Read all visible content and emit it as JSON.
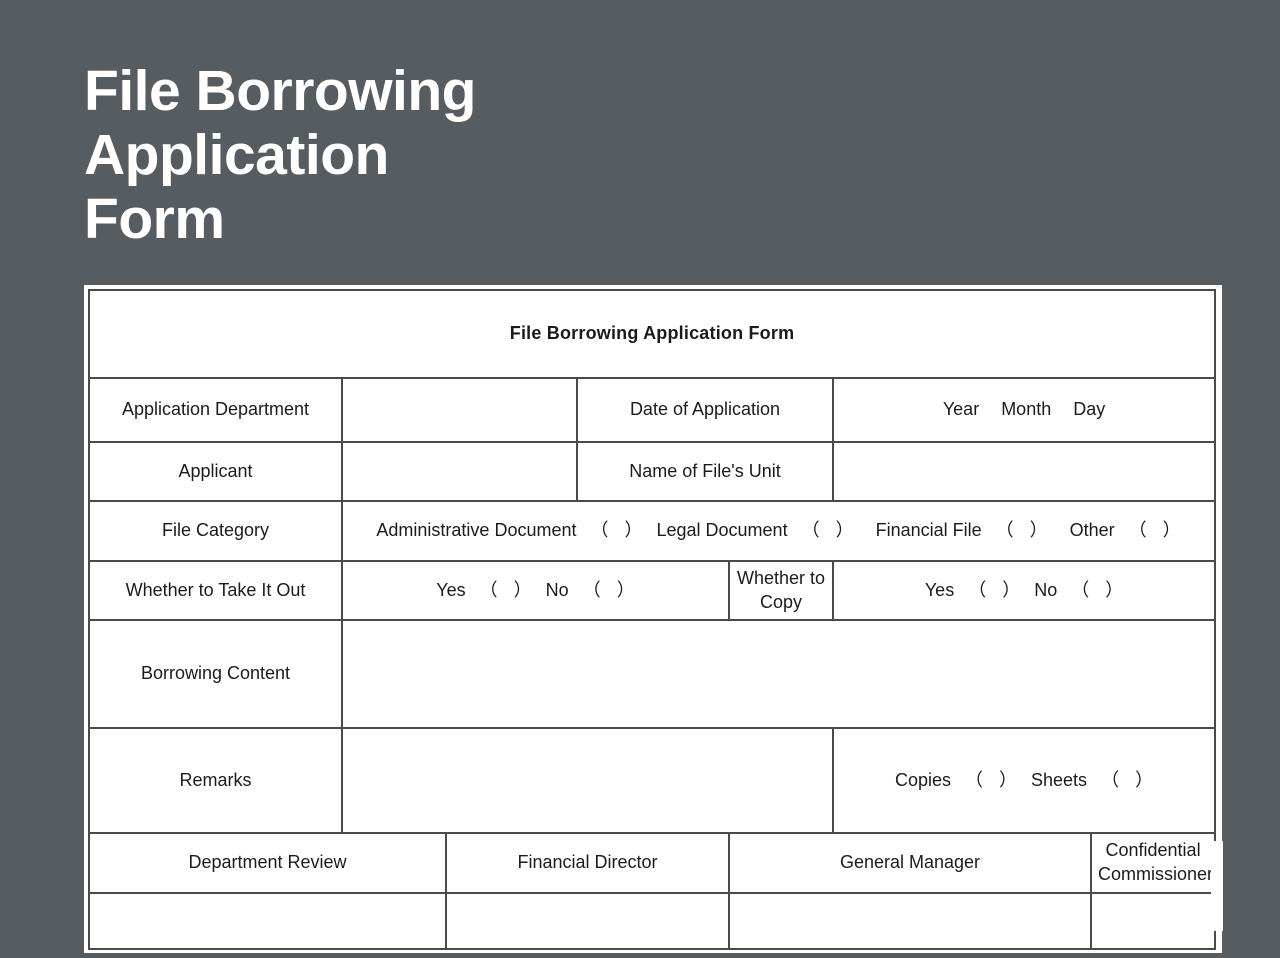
{
  "slide": {
    "title": "File Borrowing\nApplication\nForm",
    "background_color": "#575c60",
    "title_color": "#ffffff"
  },
  "form": {
    "heading": "File Borrowing Application Form",
    "rows": {
      "application_department": {
        "label": "Application Department",
        "value": "",
        "date_label": "Date of Application",
        "date_value": "Year      Month      Day",
        "date_parts": [
          "Year",
          "Month",
          "Day"
        ]
      },
      "applicant": {
        "label": "Applicant",
        "value": "",
        "unit_label": "Name of File's Unit",
        "unit_value": ""
      },
      "file_category": {
        "label": "File Category",
        "options": [
          "Administrative Document",
          "Legal Document",
          "Financial File",
          "Other"
        ],
        "checkbox_open": "（",
        "checkbox_close": "）"
      },
      "take_it_out": {
        "label": "Whether to Take It Out",
        "yes_label": "Yes",
        "no_label": "No",
        "copy_label": "Whether to Copy",
        "copy_yes_label": "Yes",
        "copy_no_label": "No"
      },
      "borrowing_content": {
        "label": "Borrowing Content",
        "value": ""
      },
      "remarks": {
        "label": "Remarks",
        "value": "",
        "copies_label": "Copies",
        "sheets_label": "Sheets"
      },
      "signatures": {
        "headers": [
          "Department Review",
          "Financial Director",
          "General Manager",
          "Confidential Commissioner"
        ],
        "values": [
          "",
          "",
          "",
          ""
        ]
      }
    }
  }
}
